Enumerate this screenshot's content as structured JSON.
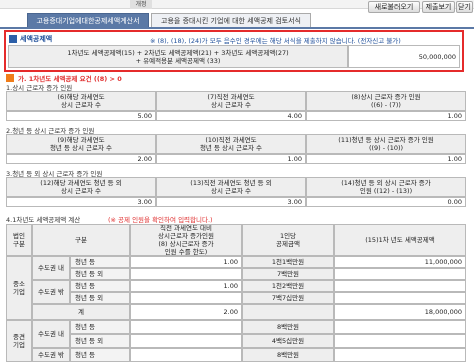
{
  "toolbar": {
    "tag": "개정",
    "refresh": "새로불러오기",
    "save": "제출보기",
    "close": "닫기"
  },
  "tabs": [
    {
      "label": "고용증대기업에대한공제세액계산서"
    },
    {
      "label": "고용을 증대시킨 기업에 대한 세액공제 검토서식"
    }
  ],
  "credit": {
    "title": "세액공제액",
    "notice": "※ (8), (18), (24)가 모두 음수인 경우에는 해당 서식을 제출하지 않습니다. (전자신고 불가)",
    "formula_line1": "1차년도 세액공제액(15) + 2차년도 세액공제액(21) + 3차년도 세액공제액(27)",
    "formula_line2": "+ 유예적용분 세액공제액 (33)",
    "amount": "50,000,000"
  },
  "section_ga": {
    "title": "가. 1차년도 세액공제 요건 ((8) > 0"
  },
  "sec1": {
    "title": "1.상시 근로자 증가 인원",
    "headers": [
      "(6)해당 과세연도\n상시 근로자 수",
      "(7)직전 과세연도\n상시 근로자 수",
      "(8)상시 근로자 증가 인원\n((6) - (7))"
    ],
    "values": [
      "5.00",
      "4.00",
      "1.00"
    ]
  },
  "sec2": {
    "title": "2.청년 등 상시 근로자 증가 인원",
    "headers": [
      "(9)해당 과세연도\n청년 등 상시 근로자 수",
      "(10)직전 과세연도\n청년 등 상시 근로자 수",
      "(11)청년 등 상시 근로자 증가 인원\n((9) - (10))"
    ],
    "values": [
      "2.00",
      "1.00",
      "1.00"
    ]
  },
  "sec3": {
    "title": "3.청년 등 외 상시 근로자 증가 인원",
    "headers": [
      "(12)해당 과세연도 청년 등 외\n상시 근로자 수",
      "(13)직전 과세연도 청년 등 외\n상시 근로자 수",
      "(14)청년 등 외 상시 근로자 증가\n인원 ((12) - (13))"
    ],
    "values": [
      "3.00",
      "3.00",
      "0.00"
    ]
  },
  "sec4": {
    "title": "4.1차년도 세액공제액 계산",
    "note": "(※ 공제 인원을 확인하여 입력합니다.)",
    "headers": {
      "corp": "법인\n구분",
      "type": "구분",
      "increase": "직전 과세연도 대비\n상시근로자 증가인원\n(8) 상시근로자 증가\n인원 수를 한도)",
      "per_person": "1인당\n공제금액",
      "credit": "(15)1차 년도 세액공제액"
    },
    "rows": [
      {
        "corp": "중소\n기업",
        "region": "수도권 내",
        "sub": "청년 등",
        "increase": "1.00",
        "per_person": "1천1백만원",
        "credit": "11,000,000"
      },
      {
        "corp": "",
        "region": "",
        "sub": "청년 등 외",
        "increase": "",
        "per_person": "7백만원",
        "credit": ""
      },
      {
        "corp": "",
        "region": "수도권 밖",
        "sub": "청년 등",
        "increase": "1.00",
        "per_person": "1천2백만원",
        "credit": ""
      },
      {
        "corp": "",
        "region": "",
        "sub": "청년 등 외",
        "increase": "",
        "per_person": "7백7십만원",
        "credit": ""
      },
      {
        "corp": "",
        "region": "계",
        "sub": "",
        "increase": "2.00",
        "per_person": "",
        "credit": "18,000,000"
      },
      {
        "corp": "중견\n기업",
        "region": "수도권 내",
        "sub": "청년 등",
        "increase": "",
        "per_person": "8백만원",
        "credit": ""
      },
      {
        "corp": "",
        "region": "",
        "sub": "청년 등 외",
        "increase": "",
        "per_person": "4백5십만원",
        "credit": ""
      },
      {
        "corp": "",
        "region": "수도권 밖",
        "sub": "청년 등",
        "increase": "",
        "per_person": "8백만원",
        "credit": ""
      }
    ]
  }
}
